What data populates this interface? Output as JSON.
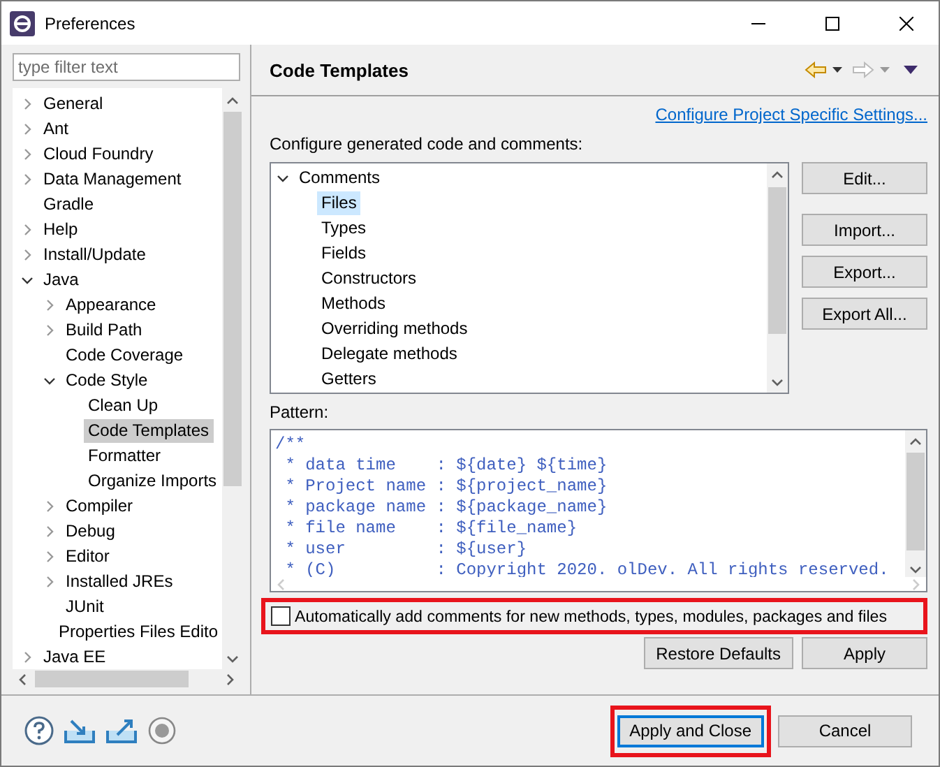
{
  "window": {
    "title": "Preferences"
  },
  "filter": {
    "placeholder": "type filter text"
  },
  "nav_tree": [
    {
      "label": "General",
      "expanded": false,
      "selected": false
    },
    {
      "label": "Ant",
      "expanded": false,
      "selected": false
    },
    {
      "label": "Cloud Foundry",
      "expanded": false,
      "selected": false
    },
    {
      "label": "Data Management",
      "expanded": false,
      "selected": false
    },
    {
      "label": "Gradle",
      "selected": false
    },
    {
      "label": "Help",
      "expanded": false,
      "selected": false
    },
    {
      "label": "Install/Update",
      "expanded": false,
      "selected": false
    },
    {
      "label": "Java",
      "expanded": true,
      "selected": false,
      "children": [
        {
          "label": "Appearance",
          "expanded": false,
          "selected": false
        },
        {
          "label": "Build Path",
          "expanded": false,
          "selected": false
        },
        {
          "label": "Code Coverage",
          "selected": false
        },
        {
          "label": "Code Style",
          "expanded": true,
          "selected": false,
          "children": [
            {
              "label": "Clean Up",
              "selected": false
            },
            {
              "label": "Code Templates",
              "selected": true
            },
            {
              "label": "Formatter",
              "selected": false
            },
            {
              "label": "Organize Imports",
              "selected": false
            }
          ]
        },
        {
          "label": "Compiler",
          "expanded": false,
          "selected": false
        },
        {
          "label": "Debug",
          "expanded": false,
          "selected": false
        },
        {
          "label": "Editor",
          "expanded": false,
          "selected": false
        },
        {
          "label": "Installed JREs",
          "expanded": false,
          "selected": false
        },
        {
          "label": "JUnit",
          "selected": false
        },
        {
          "label": "Properties Files Edito",
          "selected": false
        }
      ]
    },
    {
      "label": "Java EE",
      "expanded": false,
      "selected": false
    }
  ],
  "page": {
    "title": "Code Templates",
    "project_link": "Configure Project Specific Settings...",
    "tree_label": "Configure generated code and comments:"
  },
  "template_tree": [
    {
      "label": "Comments",
      "expanded": true,
      "selected": false,
      "children": [
        {
          "label": "Files",
          "selected": true
        },
        {
          "label": "Types",
          "selected": false
        },
        {
          "label": "Fields",
          "selected": false
        },
        {
          "label": "Constructors",
          "selected": false
        },
        {
          "label": "Methods",
          "selected": false
        },
        {
          "label": "Overriding methods",
          "selected": false
        },
        {
          "label": "Delegate methods",
          "selected": false
        },
        {
          "label": "Getters",
          "selected": false
        }
      ]
    }
  ],
  "side_buttons": [
    "Edit...",
    "Import...",
    "Export...",
    "Export All..."
  ],
  "pattern": {
    "label": "Pattern:",
    "lines": [
      "/**",
      " * data time    : ${date} ${time}",
      " * Project name : ${project_name}",
      " * package name : ${package_name}",
      " * file name    : ${file_name}",
      " * user         : ${user}",
      " * (C)          : Copyright 2020. olDev. All rights reserved."
    ]
  },
  "auto_comments": {
    "label": "Automatically add comments for new methods, types, modules, packages and files",
    "checked": false,
    "highlighted": true
  },
  "page_buttons": [
    "Restore Defaults",
    "Apply"
  ],
  "dialog_buttons": [
    {
      "label": "Apply and Close",
      "default": true,
      "highlighted": true
    },
    {
      "label": "Cancel",
      "default": false,
      "highlighted": false
    }
  ]
}
